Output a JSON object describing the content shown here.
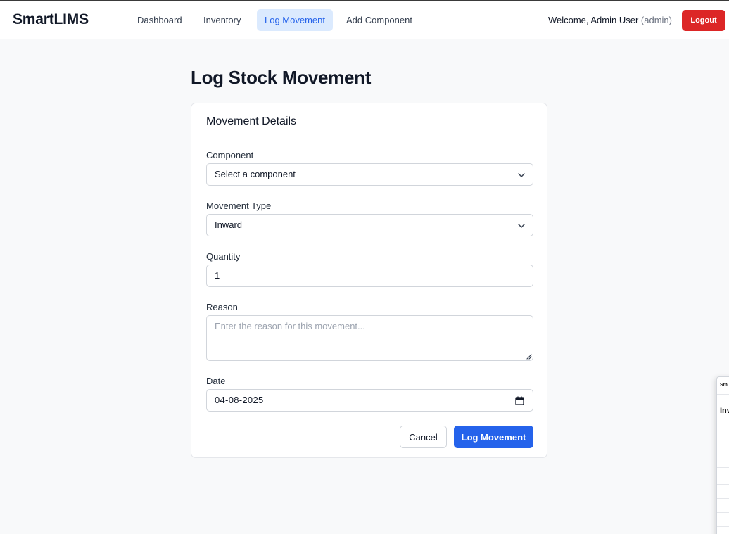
{
  "app": {
    "brand": "SmartLIMS"
  },
  "nav": {
    "items": [
      {
        "label": "Dashboard",
        "active": false
      },
      {
        "label": "Inventory",
        "active": false
      },
      {
        "label": "Log Movement",
        "active": true
      },
      {
        "label": "Add Component",
        "active": false
      }
    ]
  },
  "user": {
    "welcome": "Welcome, Admin User",
    "role": "(admin)",
    "logout_label": "Logout"
  },
  "page": {
    "title": "Log Stock Movement"
  },
  "form": {
    "card_title": "Movement Details",
    "component": {
      "label": "Component",
      "value": "Select a component"
    },
    "movement_type": {
      "label": "Movement Type",
      "value": "Inward"
    },
    "quantity": {
      "label": "Quantity",
      "value": "1"
    },
    "reason": {
      "label": "Reason",
      "placeholder": "Enter the reason for this movement..."
    },
    "date": {
      "label": "Date",
      "value": "04-08-2025"
    },
    "cancel_label": "Cancel",
    "submit_label": "Log Movement"
  },
  "overlay": {
    "brand_fragment": "Sm",
    "title_fragment": "Inv"
  },
  "colors": {
    "primary": "#2563eb",
    "danger": "#dc2626",
    "active_nav_bg": "#dbeafe"
  }
}
